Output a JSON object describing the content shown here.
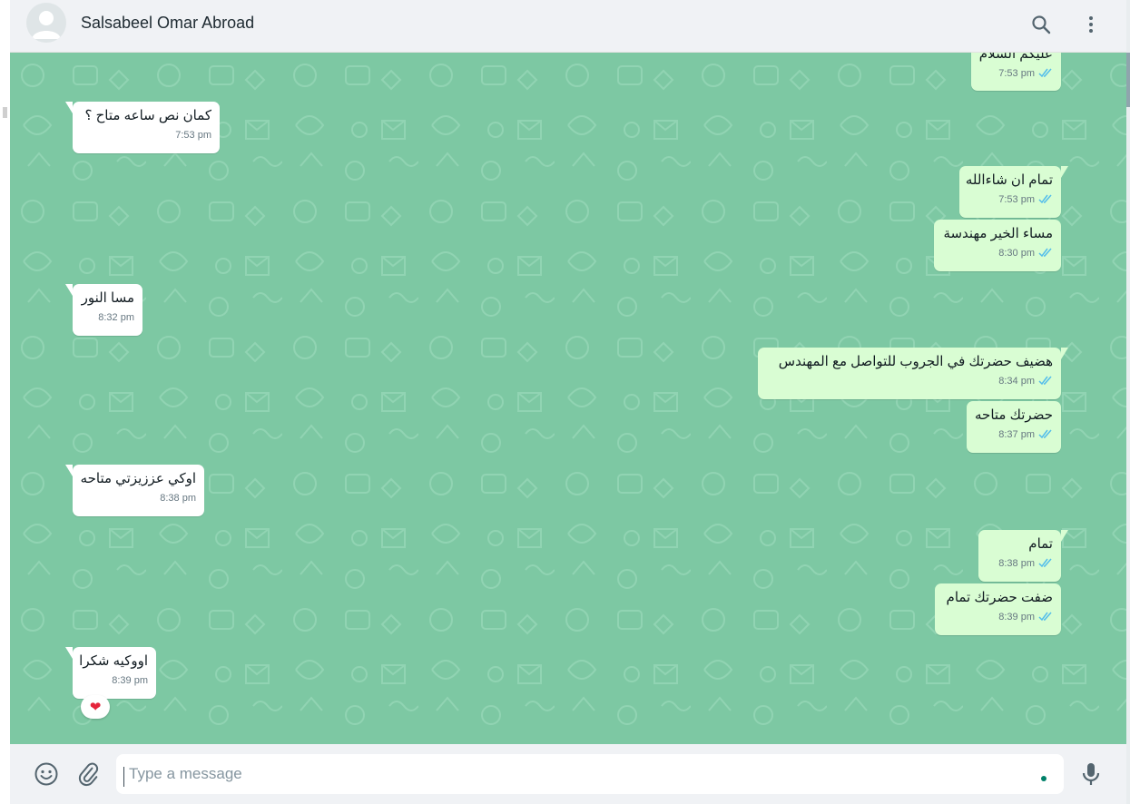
{
  "header": {
    "contact_name": "Salsabeel Omar Abroad",
    "icons": [
      "default-avatar-icon",
      "search-icon",
      "menu-dots-icon"
    ]
  },
  "messages": [
    {
      "dir": "out",
      "text": "عليكم السلام",
      "time": "7:53 pm",
      "status": "read"
    },
    {
      "dir": "in",
      "text": "كمان نص ساعه متاح ؟",
      "time": "7:53 pm"
    },
    {
      "dir": "out",
      "text": "تمام ان شاءالله",
      "time": "7:53 pm",
      "status": "read"
    },
    {
      "dir": "out",
      "text": "مساء الخير مهندسة",
      "time": "8:30 pm",
      "status": "read"
    },
    {
      "dir": "in",
      "text": "مسا النور",
      "time": "8:32 pm"
    },
    {
      "dir": "out",
      "text": "هضيف حضرتك في الجروب للتواصل مع المهندس",
      "time": "8:34 pm",
      "status": "read"
    },
    {
      "dir": "out",
      "text": "حضرتك متاحه",
      "time": "8:37 pm",
      "status": "read"
    },
    {
      "dir": "in",
      "text": "اوكي عززيزتي متاحه",
      "time": "8:38 pm"
    },
    {
      "dir": "out",
      "text": "تمام",
      "time": "8:38 pm",
      "status": "read"
    },
    {
      "dir": "out",
      "text": "ضفت حضرتك تمام",
      "time": "8:39 pm",
      "status": "read"
    },
    {
      "dir": "in",
      "text": "اووكيه شكرا",
      "time": "8:39 pm"
    }
  ],
  "reaction": {
    "emoji": "❤",
    "icon": "heart-icon"
  },
  "footer": {
    "placeholder": "Type a message",
    "icons": [
      "emoji-icon",
      "attach-icon",
      "microphone-icon"
    ]
  },
  "colors": {
    "chat_background": "#7dc8a3",
    "incoming_bubble": "#ffffff",
    "outgoing_bubble": "#d9fdd3",
    "read_ticks": "#53bdeb",
    "header_bg": "#f0f2f5"
  }
}
